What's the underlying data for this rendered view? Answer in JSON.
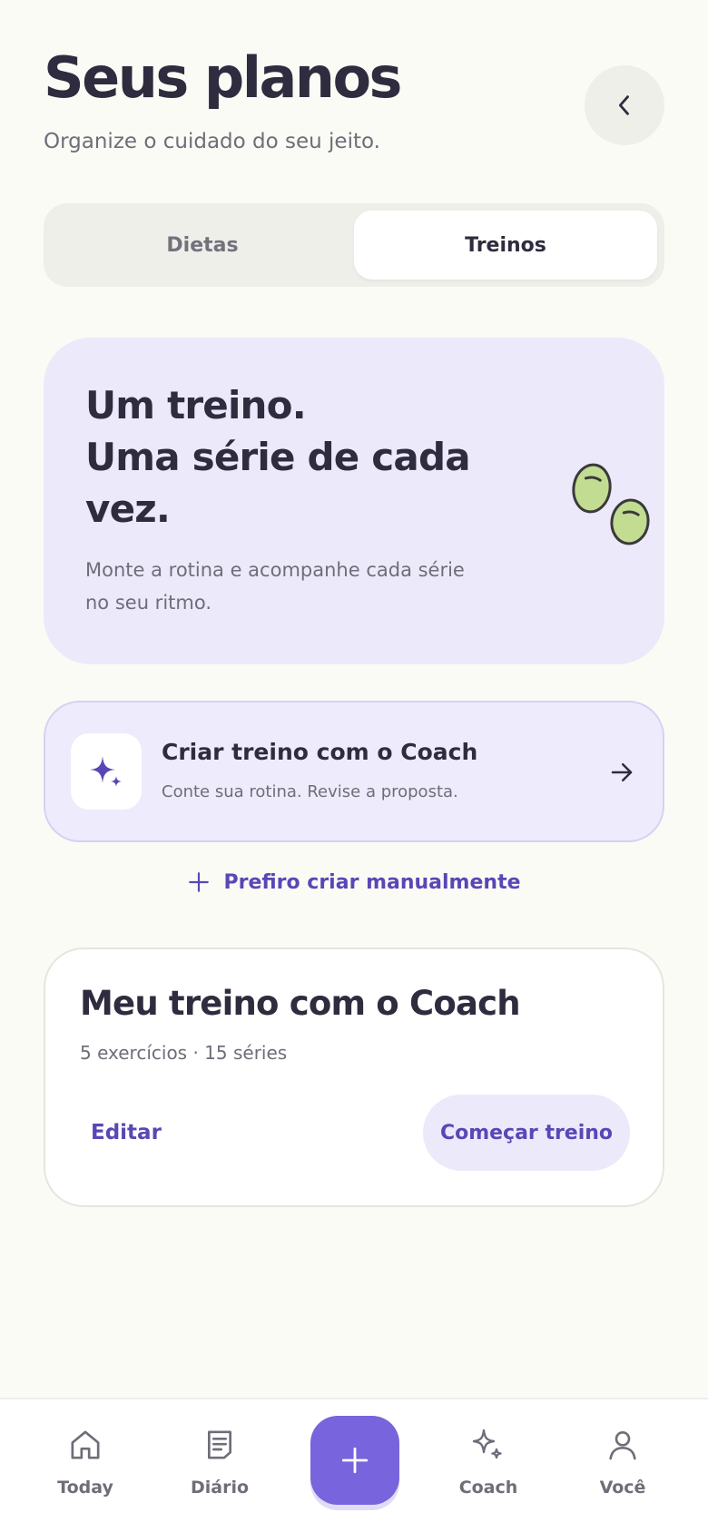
{
  "header": {
    "title": "Seus planos",
    "subtitle": "Organize o cuidado do seu jeito.",
    "back_icon": "chevron-left-icon"
  },
  "tabs": [
    {
      "label": "Dietas",
      "active": false
    },
    {
      "label": "Treinos",
      "active": true
    }
  ],
  "hero": {
    "heading_lines": [
      "Um treino.",
      "Uma série de cada",
      "vez."
    ],
    "text": "Monte a rotina e acompanhe cada série no seu ritmo.",
    "illustration": "two-green-beans"
  },
  "coach_card": {
    "title": "Criar treino com o Coach",
    "subtitle": "Conte sua rotina. Revise a proposta.",
    "icon": "sparkles-icon",
    "arrow_icon": "arrow-right-icon"
  },
  "manual_link": {
    "label": "Prefiro criar manualmente",
    "icon": "plus-icon"
  },
  "plan_card": {
    "title": "Meu treino com o Coach",
    "meta": "5 exercícios · 15 séries",
    "edit_label": "Editar",
    "start_label": "Começar treino"
  },
  "bottom_nav": {
    "items": [
      {
        "label": "Today",
        "icon": "home-icon"
      },
      {
        "label": "Diário",
        "icon": "journal-icon"
      },
      {
        "label": "Coach",
        "icon": "sparkles-icon"
      },
      {
        "label": "Você",
        "icon": "person-icon"
      }
    ],
    "fab_icon": "plus-icon"
  },
  "colors": {
    "background": "#fbfbf6",
    "accent": "#7864dc",
    "accent_text": "#5b46b6",
    "lavender": "#ece9fb",
    "bean_green": "#c2dc92"
  }
}
